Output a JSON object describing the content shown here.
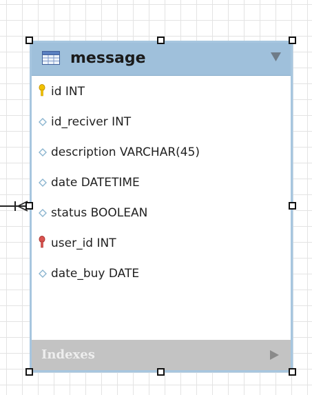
{
  "table": {
    "name": "message",
    "columns": [
      {
        "label": "id INT",
        "icon": "primary-key-icon",
        "icon_color": "#f2c200"
      },
      {
        "label": "id_reciver INT",
        "icon": "column-diamond-icon",
        "icon_color": "#8ab4cf"
      },
      {
        "label": "description VARCHAR(45)",
        "icon": "column-diamond-icon",
        "icon_color": "#8ab4cf"
      },
      {
        "label": "date DATETIME",
        "icon": "column-diamond-icon",
        "icon_color": "#8ab4cf"
      },
      {
        "label": "status BOOLEAN",
        "icon": "column-diamond-icon",
        "icon_color": "#8ab4cf"
      },
      {
        "label": "user_id INT",
        "icon": "foreign-key-icon",
        "icon_color": "#d9534f"
      },
      {
        "label": "date_buy DATE",
        "icon": "column-diamond-icon",
        "icon_color": "#8ab4cf"
      }
    ],
    "indexes_label": "Indexes"
  },
  "colors": {
    "header": "#9fc0db",
    "border": "#a7c6df",
    "indexes_bar": "#c3c3c3"
  }
}
